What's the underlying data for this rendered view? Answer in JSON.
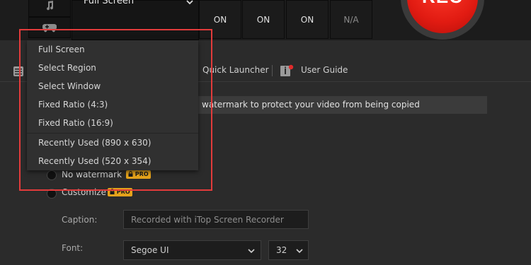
{
  "capture": {
    "mode_label": "Full Screen",
    "status": [
      "ON",
      "ON",
      "ON",
      "N/A"
    ]
  },
  "record_button": {
    "label": "REC"
  },
  "nav": {
    "quick_launcher": "Quick Launcher",
    "user_guide": "User Guide"
  },
  "watermark": {
    "banner_text": "watermark to protect your video from being copied",
    "no_watermark_label": "No watermark",
    "customize_label": "Customize",
    "pro_badge": "PRO",
    "caption_label": "Caption:",
    "caption_placeholder": "Recorded with iTop Screen Recorder",
    "font_label": "Font:",
    "font_value": "Segoe UI",
    "size_value": "32"
  },
  "dropdown": {
    "items": [
      "Full Screen",
      "Select Region",
      "Select Window",
      "Fixed Ratio (4:3)",
      "Fixed Ratio (16:9)",
      "Recently Used (890 x 630)",
      "Recently Used (520 x 354)"
    ]
  },
  "colors": {
    "rec_red": "#e11b12",
    "highlight_border": "#e23b3b",
    "pro_badge": "#e4a21b"
  }
}
